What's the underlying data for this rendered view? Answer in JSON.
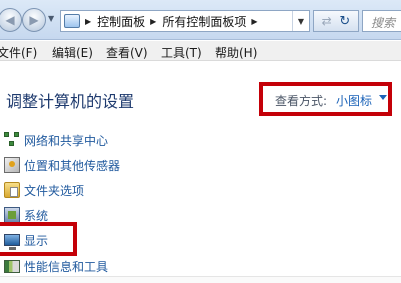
{
  "address_bar": {
    "breadcrumbs": [
      "控制面板",
      "所有控制面板项"
    ],
    "search_placeholder": "搜索"
  },
  "menu": {
    "items": [
      "文件(F)",
      "编辑(E)",
      "查看(V)",
      "工具(T)",
      "帮助(H)"
    ]
  },
  "header": {
    "title": "调整计算机的设置",
    "view_by_label": "查看方式:",
    "view_by_value": "小图标"
  },
  "items": [
    {
      "label": "网络和共享中心",
      "icon": "network-icon"
    },
    {
      "label": "位置和其他传感器",
      "icon": "location-sensor-icon"
    },
    {
      "label": "文件夹选项",
      "icon": "folder-options-icon"
    },
    {
      "label": "系统",
      "icon": "system-icon"
    },
    {
      "label": "显示",
      "icon": "display-icon"
    },
    {
      "label": "性能信息和工具",
      "icon": "performance-icon"
    }
  ],
  "colors": {
    "highlight_border": "#c40008",
    "link": "#215a9e",
    "title": "#1e3a6e"
  }
}
